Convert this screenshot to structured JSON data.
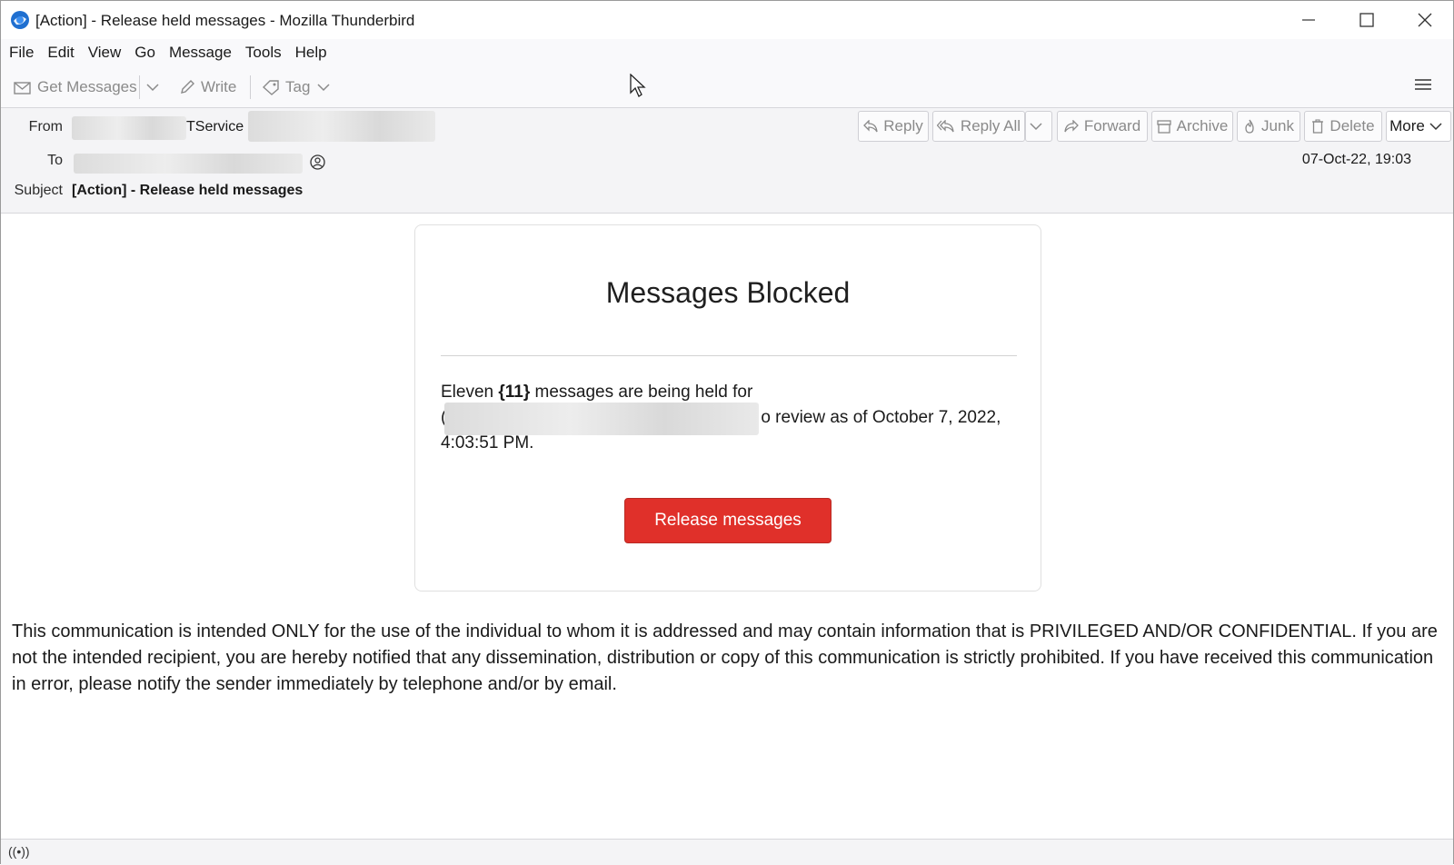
{
  "window": {
    "title": "[Action] - Release held messages - Mozilla Thunderbird",
    "app_icon": "thunderbird-logo-icon",
    "controls": [
      "minimize-icon",
      "maximize-icon",
      "close-icon"
    ]
  },
  "menubar": {
    "items": [
      {
        "label": "File"
      },
      {
        "label": "Edit"
      },
      {
        "label": "View"
      },
      {
        "label": "Go"
      },
      {
        "label": "Message"
      },
      {
        "label": "Tools"
      },
      {
        "label": "Help"
      }
    ]
  },
  "toolbar": {
    "get_messages": "Get Messages",
    "write": "Write",
    "tag": "Tag"
  },
  "header": {
    "from_label": "From",
    "from_value": "TService",
    "to_label": "To",
    "subject_label": "Subject",
    "subject_value": "[Action] - Release held messages",
    "date": "07-Oct-22, 19:03",
    "actions": {
      "reply": "Reply",
      "reply_all": "Reply All",
      "forward": "Forward",
      "archive": "Archive",
      "junk": "Junk",
      "delete": "Delete",
      "more": "More"
    }
  },
  "message": {
    "title": "Messages Blocked",
    "text_part1": "Eleven ",
    "text_bold": "{11}",
    "text_part2": " messages are being held for",
    "text_line2_start": "(",
    "text_line2_end": "o review as of October 7, 2022,",
    "text_line3": "4:03:51 PM.",
    "button": "Release messages",
    "button_color": "#e0302a",
    "disclaimer": "This communication is intended ONLY for the use of the individual to whom it is addressed and may contain information that is PRIVILEGED AND/OR CONFIDENTIAL. If you are not the intended recipient, you are hereby notified that any dissemination, distribution or copy of this communication is strictly prohibited. If you have received this communication in error, please notify the sender immediately by telephone and/or by email."
  },
  "statusbar": {
    "icon": "online-status-icon",
    "glyph": "((•))"
  }
}
